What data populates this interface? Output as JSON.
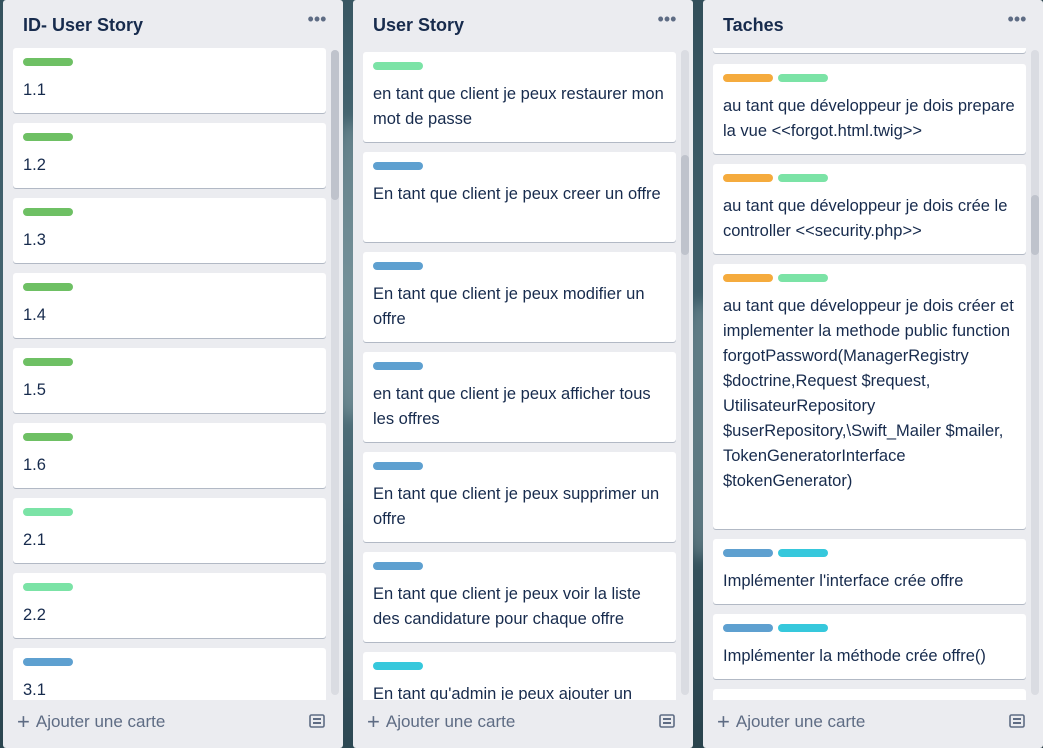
{
  "colors": {
    "green": "#6ec064",
    "light_green": "#7be3a6",
    "blue": "#5ea0d0",
    "cyan": "#36c8dc",
    "orange": "#f5ab3d"
  },
  "lists": [
    {
      "title": "ID- User Story",
      "add_label": "Ajouter une carte",
      "cards": [
        {
          "labels": [
            "green"
          ],
          "text": "1.1"
        },
        {
          "labels": [
            "green"
          ],
          "text": "1.2"
        },
        {
          "labels": [
            "green"
          ],
          "text": "1.3"
        },
        {
          "labels": [
            "green"
          ],
          "text": "1.4"
        },
        {
          "labels": [
            "green"
          ],
          "text": "1.5"
        },
        {
          "labels": [
            "green"
          ],
          "text": "1.6"
        },
        {
          "labels": [
            "light_green"
          ],
          "text": "2.1"
        },
        {
          "labels": [
            "light_green"
          ],
          "text": "2.2"
        },
        {
          "labels": [
            "blue"
          ],
          "text": "3.1"
        }
      ]
    },
    {
      "title": "User Story",
      "add_label": "Ajouter une carte",
      "cards": [
        {
          "labels": [
            "light_green"
          ],
          "text": "en tant que client je peux restaurer mon mot de passe"
        },
        {
          "labels": [
            "blue"
          ],
          "text": "En tant que client je peux creer un offre"
        },
        {
          "labels": [
            "blue"
          ],
          "text": "En tant que client je peux modifier un offre"
        },
        {
          "labels": [
            "blue"
          ],
          "text": "en tant que client je peux afficher tous les offres"
        },
        {
          "labels": [
            "blue"
          ],
          "text": "En tant que client je peux supprimer un offre"
        },
        {
          "labels": [
            "blue"
          ],
          "text": "En tant que client je peux voir la liste des candidature pour chaque offre"
        },
        {
          "labels": [
            "cyan"
          ],
          "text": "En tant qu'admin je peux ajouter un"
        }
      ]
    },
    {
      "title": "Taches",
      "add_label": "Ajouter une carte",
      "cards": [
        {
          "labels": [
            "orange",
            "light_green"
          ],
          "text": "au tant que développeur je dois prepare la vue <<forgot.html.twig>>"
        },
        {
          "labels": [
            "orange",
            "light_green"
          ],
          "text": "au tant que développeur je dois crée le controller <<security.php>>"
        },
        {
          "labels": [
            "orange",
            "light_green"
          ],
          "text": "au tant que développeur je dois créer et implementer la methode public function forgotPassword(ManagerRegistry $doctrine,Request $request, UtilisateurRepository $userRepository,\\Swift_Mailer $mailer, TokenGeneratorInterface $tokenGenerator)"
        },
        {
          "labels": [
            "blue",
            "cyan"
          ],
          "text": "Implémenter l'interface crée offre"
        },
        {
          "labels": [
            "blue",
            "cyan"
          ],
          "text": "Implémenter la méthode crée offre()"
        }
      ]
    }
  ]
}
